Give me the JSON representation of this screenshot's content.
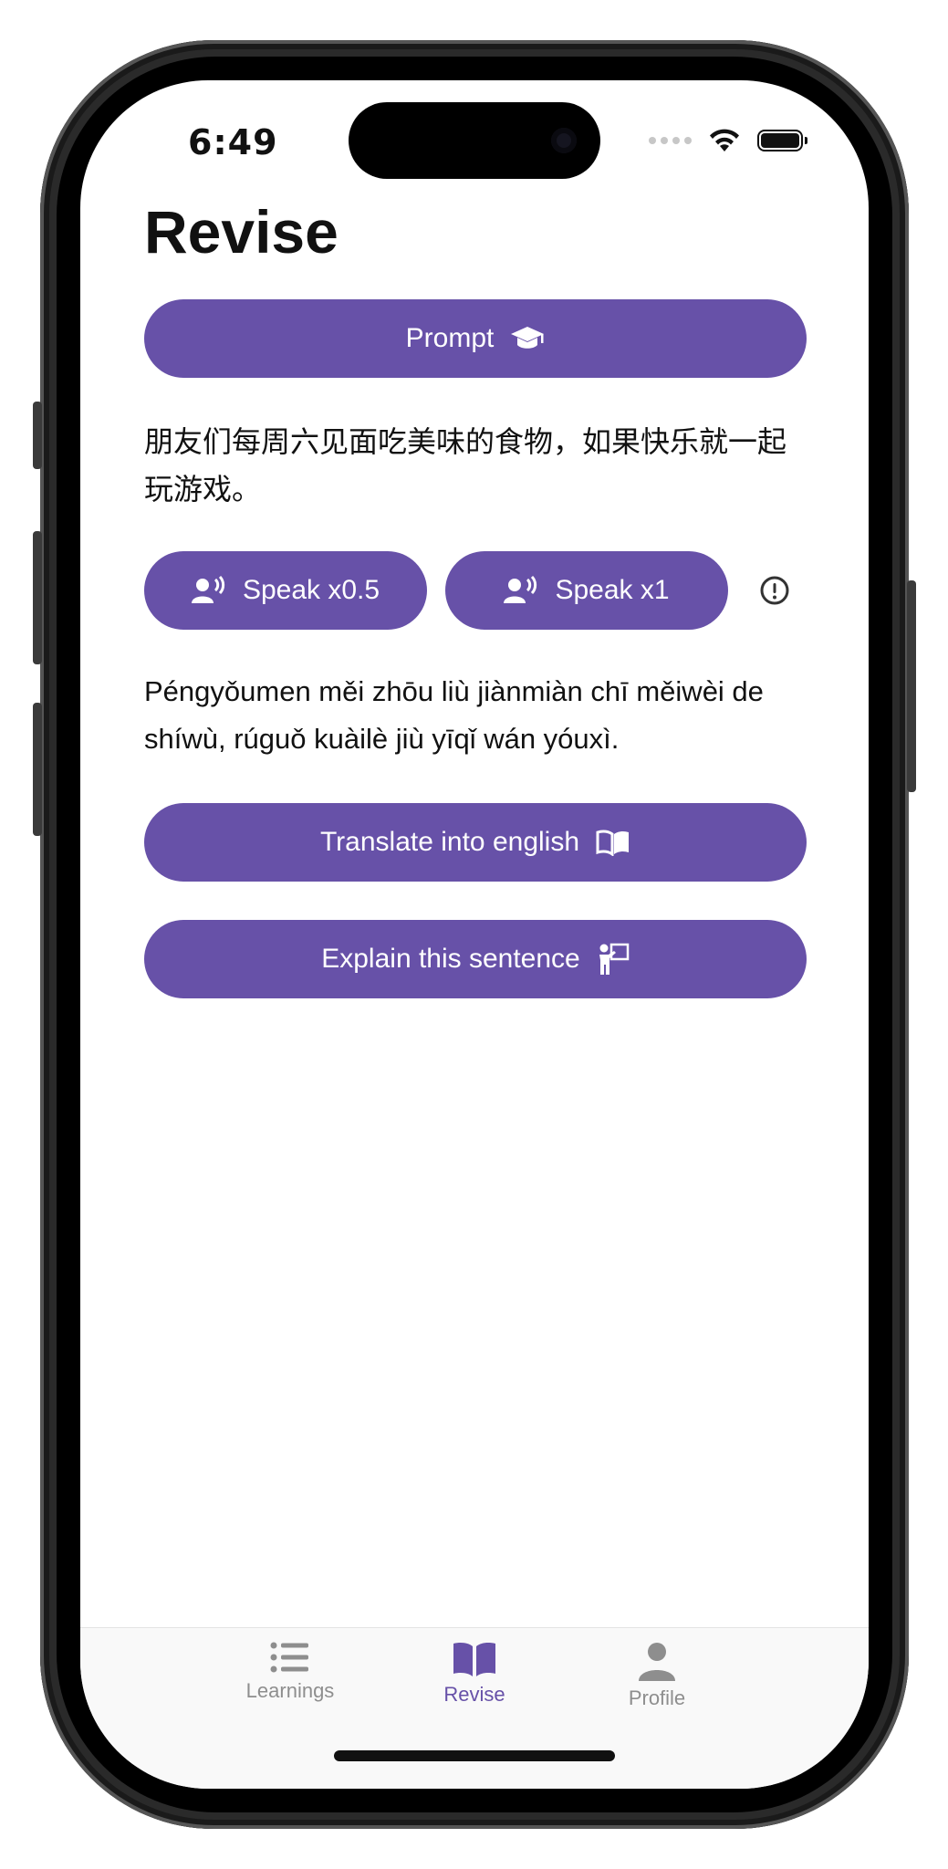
{
  "status": {
    "time": "6:49"
  },
  "page": {
    "title": "Revise"
  },
  "buttons": {
    "prompt": "Prompt",
    "speak_slow": "Speak x0.5",
    "speak_normal": "Speak x1",
    "translate": "Translate into english",
    "explain": "Explain this sentence"
  },
  "sentence": {
    "chinese": "朋友们每周六见面吃美味的食物，如果快乐就一起玩游戏。",
    "pinyin": "Péngyǒumen měi zhōu liù jiànmiàn chī měiwèi de shíwù, rúguǒ kuàilè jiù yīqǐ wán yóuxì."
  },
  "tabs": [
    {
      "label": "Learnings",
      "icon": "list-icon",
      "active": false
    },
    {
      "label": "Revise",
      "icon": "book-open-icon",
      "active": true
    },
    {
      "label": "Profile",
      "icon": "user-icon",
      "active": false
    }
  ],
  "colors": {
    "accent": "#6751a8",
    "tab_inactive": "#8e8e8e",
    "text": "#111111"
  }
}
